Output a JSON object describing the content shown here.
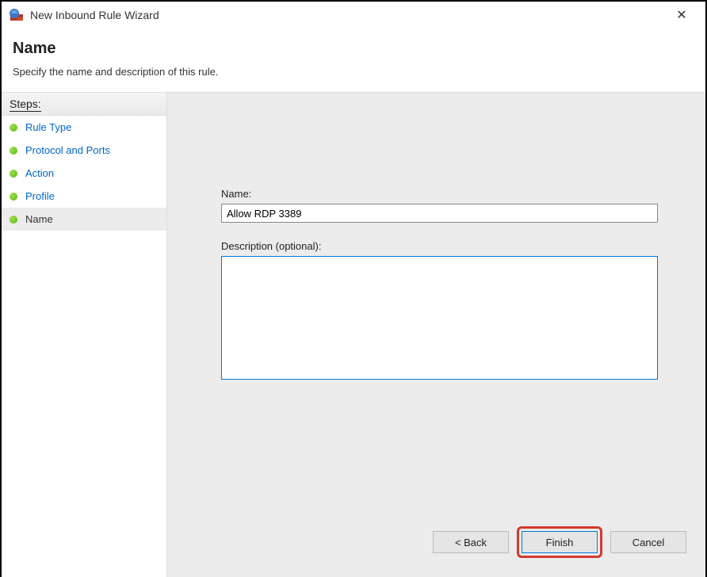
{
  "window": {
    "title": "New Inbound Rule Wizard"
  },
  "header": {
    "title": "Name",
    "subtitle": "Specify the name and description of this rule."
  },
  "sidebar": {
    "heading": "Steps:",
    "items": [
      {
        "label": "Rule Type",
        "active": false
      },
      {
        "label": "Protocol and Ports",
        "active": false
      },
      {
        "label": "Action",
        "active": false
      },
      {
        "label": "Profile",
        "active": false
      },
      {
        "label": "Name",
        "active": true
      }
    ]
  },
  "form": {
    "name_label": "Name:",
    "name_value": "Allow RDP 3389",
    "description_label": "Description (optional):",
    "description_value": ""
  },
  "buttons": {
    "back": "< Back",
    "finish": "Finish",
    "cancel": "Cancel"
  }
}
